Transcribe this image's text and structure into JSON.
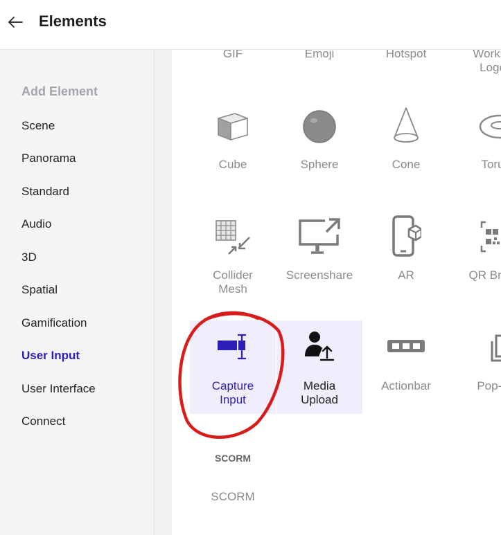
{
  "header": {
    "title": "Elements",
    "back_icon": "arrow-left-icon"
  },
  "sidebar": {
    "heading": "Add Element",
    "items": [
      "Scene",
      "Panorama",
      "Standard",
      "Audio",
      "3D",
      "Spatial",
      "Gamification",
      "User Input",
      "User Interface",
      "Connect"
    ],
    "active": "User Input"
  },
  "grid": {
    "row0": [
      "GIF",
      "Emoji",
      "Hotspot",
      "Worksp"
    ],
    "row0_line2": "Logo",
    "row1": [
      "Cube",
      "Sphere",
      "Cone",
      "Toru"
    ],
    "row2": {
      "collider_1": "Collider",
      "collider_2": "Mesh",
      "screenshare": "Screenshare",
      "ar": "AR",
      "qr": "QR Brow"
    },
    "row3": {
      "capture_1": "Capture",
      "capture_2": "Input",
      "media_1": "Media",
      "media_2": "Upload",
      "actionbar": "Actionbar",
      "popup": "Pop-u"
    },
    "scorm_section": "SCORM",
    "scorm_item": "SCORM"
  },
  "colors": {
    "accent": "#2c1fb8",
    "selected_bg": "#f0edfc",
    "annotation": "#d81c1c",
    "icon_gray": "#8a8a8a"
  }
}
